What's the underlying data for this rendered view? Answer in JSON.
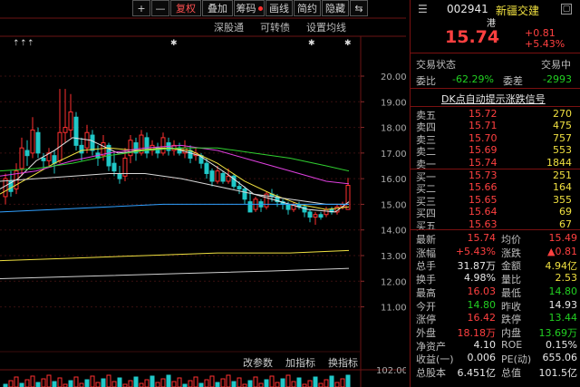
{
  "toolbar": {
    "buttons": [
      "+",
      "—",
      "复权",
      "叠加",
      "筹码",
      "画线",
      "简约",
      "隐藏",
      "⇆"
    ],
    "dark_buttons": [
      "画线",
      "简约",
      "隐藏"
    ]
  },
  "subbar": [
    "深股通",
    "可转债",
    "设置均线"
  ],
  "price_axis": [
    "20.00",
    "19.00",
    "18.00",
    "17.00",
    "16.00",
    "15.00",
    "14.00",
    "13.00",
    "12.00",
    "11.00"
  ],
  "bottom_bar": [
    "改参数",
    "加指标",
    "换指标"
  ],
  "volume_axis_label": "102.00",
  "stock": {
    "code": "002941",
    "name": "新疆交建",
    "tag": "港",
    "price": "15.74",
    "change": "+0.81",
    "change_pct": "+5.43%"
  },
  "status": {
    "label": "交易状态",
    "value": "交易中"
  },
  "weibi": {
    "label1": "委比",
    "v1": "-62.29%",
    "label2": "委差",
    "v2": "-2993"
  },
  "signal": "DK点自动提示涨跌信号",
  "asks": [
    {
      "label": "卖五",
      "price": "15.72",
      "vol": "270"
    },
    {
      "label": "卖四",
      "price": "15.71",
      "vol": "475"
    },
    {
      "label": "卖三",
      "price": "15.70",
      "vol": "757"
    },
    {
      "label": "卖二",
      "price": "15.69",
      "vol": "553"
    },
    {
      "label": "卖一",
      "price": "15.74",
      "vol": "1844"
    }
  ],
  "bids": [
    {
      "label": "买一",
      "price": "15.73",
      "vol": "251"
    },
    {
      "label": "买二",
      "price": "15.66",
      "vol": "164"
    },
    {
      "label": "买三",
      "price": "15.65",
      "vol": "355"
    },
    {
      "label": "买四",
      "price": "15.64",
      "vol": "69"
    },
    {
      "label": "买五",
      "price": "15.63",
      "vol": "67"
    }
  ],
  "stats": [
    {
      "l1": "最新",
      "v1": "15.74",
      "c1": "red",
      "l2": "均价",
      "v2": "15.49",
      "c2": "red"
    },
    {
      "l1": "涨幅",
      "v1": "+5.43%",
      "c1": "red",
      "l2": "涨跌",
      "v2": "▲0.81",
      "c2": "red"
    },
    {
      "l1": "总手",
      "v1": "31.87万",
      "c1": "white",
      "l2": "金额",
      "v2": "4.94亿",
      "c2": "yellow"
    },
    {
      "l1": "换手",
      "v1": "4.98%",
      "c1": "white",
      "l2": "量比",
      "v2": "2.53",
      "c2": "yellow"
    },
    {
      "l1": "最高",
      "v1": "16.03",
      "c1": "red",
      "l2": "最低",
      "v2": "14.80",
      "c2": "green"
    },
    {
      "l1": "今开",
      "v1": "14.80",
      "c1": "green",
      "l2": "昨收",
      "v2": "14.93",
      "c2": "white"
    },
    {
      "l1": "涨停",
      "v1": "16.42",
      "c1": "red",
      "l2": "跌停",
      "v2": "13.44",
      "c2": "green"
    },
    {
      "l1": "外盘",
      "v1": "18.18万",
      "c1": "red",
      "l2": "内盘",
      "v2": "13.69万",
      "c2": "green"
    },
    {
      "l1": "净资产",
      "v1": "4.10",
      "c1": "white",
      "l2": "ROE",
      "v2": "0.15%",
      "c2": "white"
    },
    {
      "l1": "收益(一)",
      "v1": "0.006",
      "c1": "white",
      "l2": "PE(动)",
      "v2": "655.06",
      "c2": "white"
    },
    {
      "l1": "总股本",
      "v1": "6.451亿",
      "c1": "white",
      "l2": "总值",
      "v2": "101.5亿",
      "c2": "white"
    }
  ],
  "colors": {
    "up": "#ff4040",
    "down": "#22d022",
    "accent": "#f0e040",
    "border": "#7a1010"
  }
}
